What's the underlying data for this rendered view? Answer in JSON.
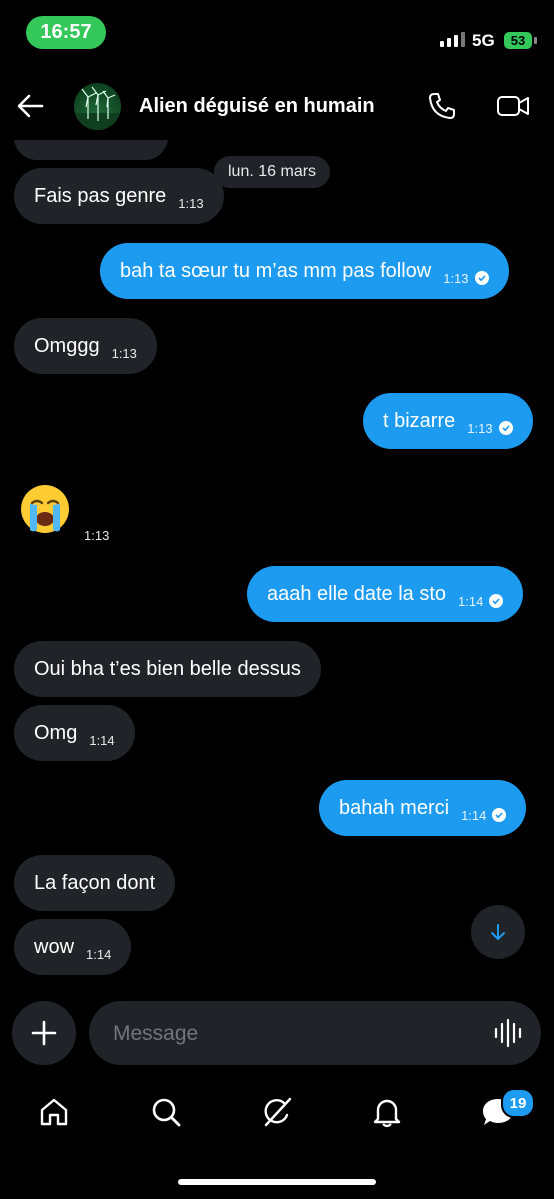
{
  "status_bar": {
    "time": "16:57",
    "network": "5G",
    "battery": "53"
  },
  "header": {
    "contact_name": "Alien déguisé en humain"
  },
  "chat": {
    "date_separator": "lun. 16 mars",
    "messages": [
      {
        "direction": "in",
        "text": "Fais pas genre",
        "time": "1:13"
      },
      {
        "direction": "out",
        "text": "bah ta sœur tu m’as mm pas follow",
        "time": "1:13"
      },
      {
        "direction": "in",
        "text": "Omggg",
        "time": "1:13"
      },
      {
        "direction": "out",
        "text": "t bizarre",
        "time": "1:13"
      },
      {
        "direction": "in",
        "text": "😭",
        "time": "1:13"
      },
      {
        "direction": "out",
        "text": "aaah elle date la sto",
        "time": "1:14"
      },
      {
        "direction": "in",
        "text": "Oui bha t’es bien belle dessus",
        "time": ""
      },
      {
        "direction": "in",
        "text": "Omg",
        "time": "1:14"
      },
      {
        "direction": "out",
        "text": "bahah merci",
        "time": "1:14"
      },
      {
        "direction": "in",
        "text": "La façon dont",
        "time": ""
      },
      {
        "direction": "in",
        "text": "wow",
        "time": "1:14"
      }
    ]
  },
  "composer": {
    "placeholder": "Message"
  },
  "tabbar": {
    "messages_badge": "19"
  },
  "colors": {
    "accent": "#1d9bf0",
    "incoming_bubble": "#202327",
    "time_pill": "#34c759"
  }
}
